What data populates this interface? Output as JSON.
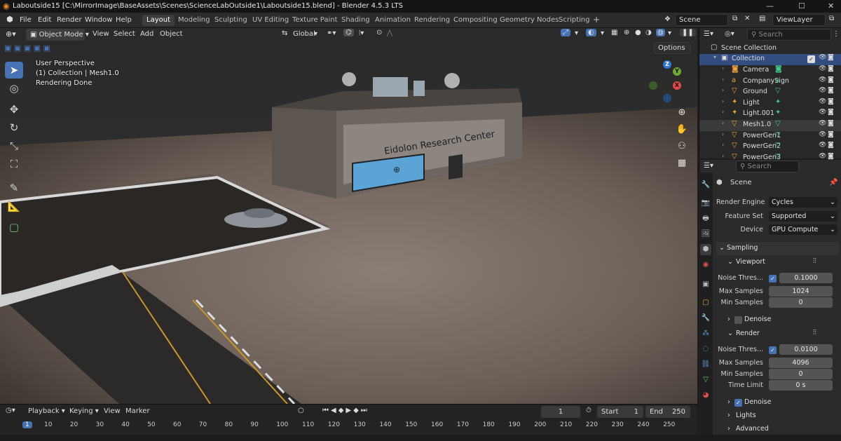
{
  "window": {
    "title": "Laboutside15 [C:\\MirrorImage\\BaseAssets\\Scenes\\ScienceLabOutside1\\Laboutside15.blend] - Blender 4.5.3 LTS",
    "minimize": "—",
    "maximize": "☐",
    "close": "✕"
  },
  "menu": [
    "File",
    "Edit",
    "Render",
    "Window",
    "Help"
  ],
  "workspaces": [
    "Layout",
    "Modeling",
    "Sculpting",
    "UV Editing",
    "Texture Paint",
    "Shading",
    "Animation",
    "Rendering",
    "Compositing",
    "Geometry Nodes",
    "Scripting"
  ],
  "active_workspace": "Layout",
  "add_workspace": "+",
  "scene_selector": "Scene",
  "viewlayer_selector": "ViewLayer",
  "viewport_header": {
    "mode": "Object Mode",
    "menus": [
      "View",
      "Select",
      "Add",
      "Object"
    ],
    "orientation": "Global",
    "options": "Options"
  },
  "viewport_overlay": {
    "perspective": "User Perspective",
    "collection": "(1) Collection | Mesh1.0",
    "status": "Rendering Done"
  },
  "scene_text": {
    "sign": "Eidolon Research Center"
  },
  "gizmo": {
    "x": "X",
    "y": "Y",
    "z": "Z"
  },
  "outliner": {
    "search_placeholder": "Search",
    "root": "Scene Collection",
    "collection": "Collection",
    "items": [
      {
        "name": "Camera",
        "icon": "camera-icon",
        "color": "#f0a040"
      },
      {
        "name": "CompanySign",
        "icon": "text-object-icon",
        "color": "#f0a040"
      },
      {
        "name": "Ground",
        "icon": "mesh-icon",
        "color": "#f0a040"
      },
      {
        "name": "Light",
        "icon": "light-icon",
        "color": "#f0a040"
      },
      {
        "name": "Light.001",
        "icon": "light-icon",
        "color": "#f0a040"
      },
      {
        "name": "Mesh1.0",
        "icon": "mesh-icon",
        "color": "#f0a040"
      },
      {
        "name": "PowerGen1",
        "icon": "mesh-icon",
        "color": "#f0a040"
      },
      {
        "name": "PowerGen2",
        "icon": "mesh-icon",
        "color": "#f0a040"
      },
      {
        "name": "PowerGen3",
        "icon": "mesh-icon",
        "color": "#f0a040"
      }
    ]
  },
  "properties": {
    "search_placeholder": "Search",
    "context": "Scene",
    "render_engine_label": "Render Engine",
    "render_engine": "Cycles",
    "feature_set_label": "Feature Set",
    "feature_set": "Supported",
    "device_label": "Device",
    "device": "GPU Compute",
    "sampling": "Sampling",
    "viewport_panel": "Viewport",
    "vp_noise_label": "Noise Thres...",
    "vp_noise": "0.1000",
    "vp_max_label": "Max Samples",
    "vp_max": "1024",
    "vp_min_label": "Min Samples",
    "vp_min": "0",
    "vp_denoise": "Denoise",
    "render_panel": "Render",
    "r_noise_label": "Noise Thres...",
    "r_noise": "0.0100",
    "r_max_label": "Max Samples",
    "r_max": "4096",
    "r_min_label": "Min Samples",
    "r_min": "0",
    "r_time_label": "Time Limit",
    "r_time": "0 s",
    "r_denoise": "Denoise",
    "lights": "Lights",
    "advanced": "Advanced"
  },
  "timeline": {
    "menus": [
      "Playback",
      "Keying",
      "View",
      "Marker"
    ],
    "current_frame": "1",
    "start_label": "Start",
    "start": "1",
    "end_label": "End",
    "end": "250",
    "ruler": [
      "1",
      "10",
      "20",
      "30",
      "40",
      "50",
      "60",
      "70",
      "80",
      "90",
      "100",
      "110",
      "120",
      "130",
      "140",
      "150",
      "160",
      "170",
      "180",
      "190",
      "200",
      "210",
      "220",
      "230",
      "240",
      "250"
    ]
  }
}
